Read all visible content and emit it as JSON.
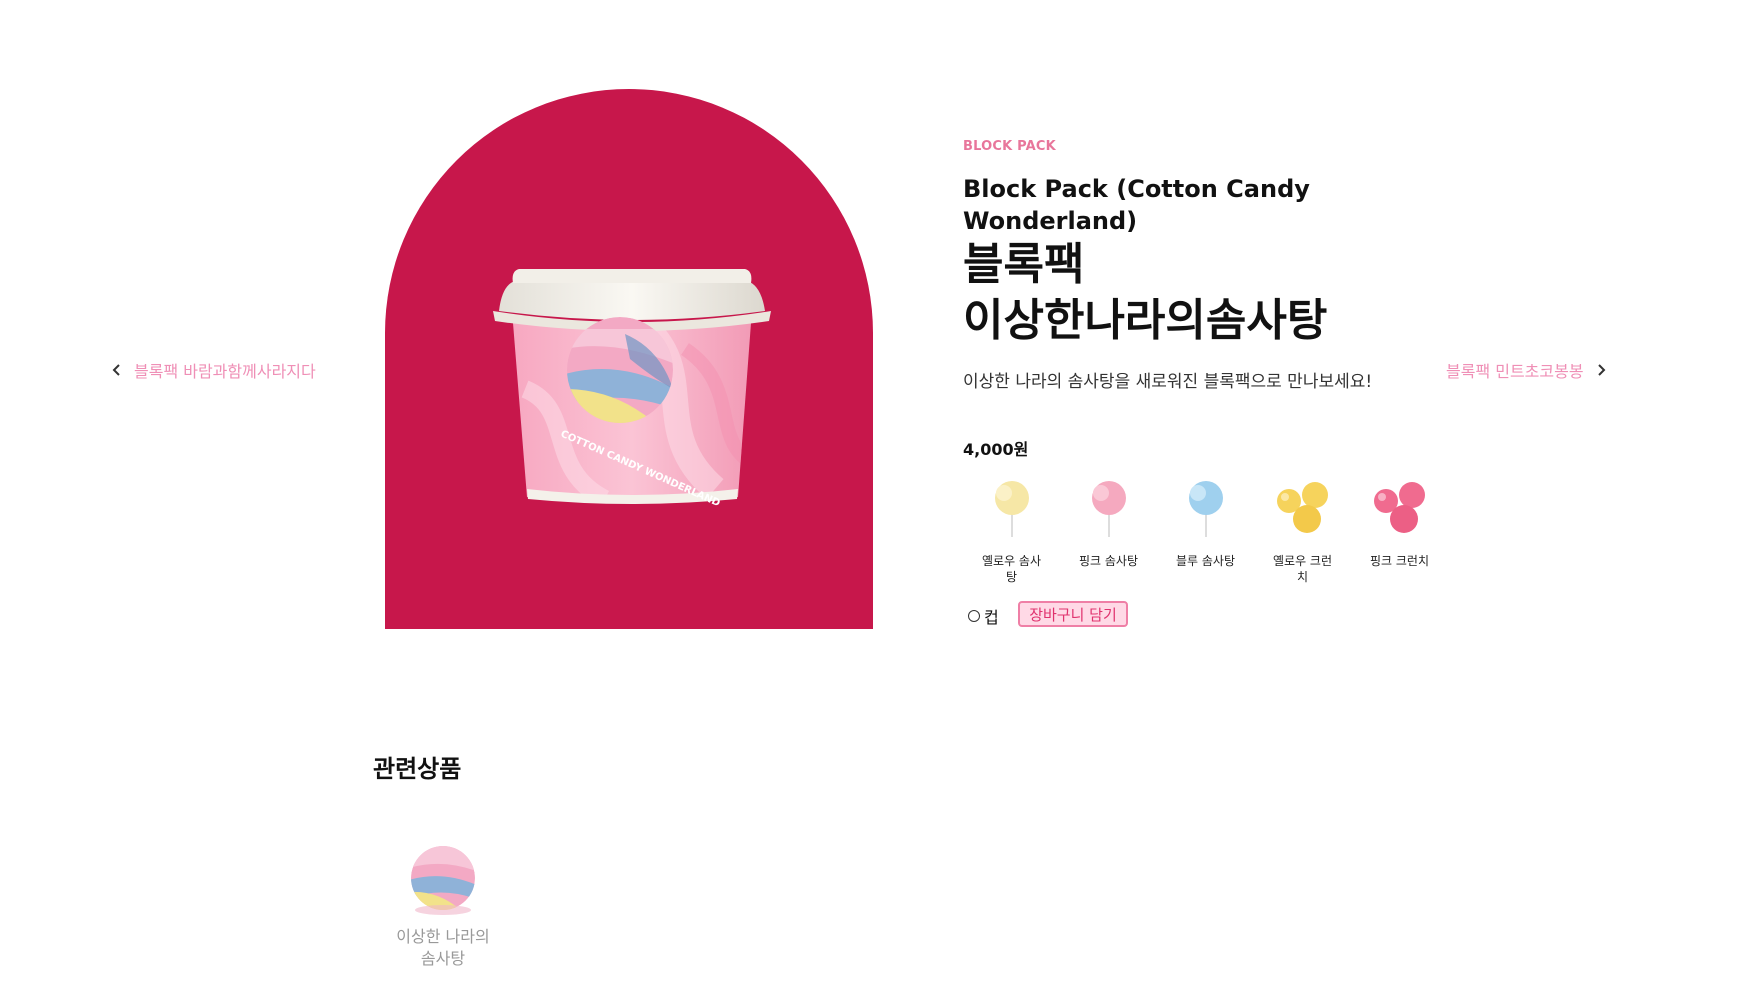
{
  "nav": {
    "prev_label": "블록팩 바람과함께사라지다",
    "next_label": "블록팩 민트초코봉봉"
  },
  "hero": {
    "background_color": "#c7174b",
    "cup_print": "COTTON CANDY WONDERLAND"
  },
  "product": {
    "eyebrow": "BLOCK PACK",
    "name_en": "Block Pack (Cotton Candy Wonderland)",
    "name_ko_line1": "블록팩",
    "name_ko_line2": "이상한나라의솜사탕",
    "description": "이상한 나라의 솜사탕을 새로워진 블록팩으로 만나보세요!",
    "price": "4,000원"
  },
  "ingredients": [
    {
      "label": "옐로우 솜사탕",
      "icon": "yellow-cotton-candy-icon",
      "color": "#f6e7a6"
    },
    {
      "label": "핑크 솜사탕",
      "icon": "pink-cotton-candy-icon",
      "color": "#f5a9bf"
    },
    {
      "label": "블루 솜사탕",
      "icon": "blue-cotton-candy-icon",
      "color": "#9fd0ee"
    },
    {
      "label": "옐로우 크런치",
      "icon": "yellow-crunch-icon",
      "color": "#f6d35c"
    },
    {
      "label": "핑크 크런치",
      "icon": "pink-crunch-icon",
      "color": "#f06b8f"
    }
  ],
  "options": {
    "cup_label": "컵"
  },
  "actions": {
    "cart_label": "장바구니 담기"
  },
  "related": {
    "title": "관련상품",
    "items": [
      {
        "name": "이상한 나라의 솜사탕"
      }
    ]
  }
}
